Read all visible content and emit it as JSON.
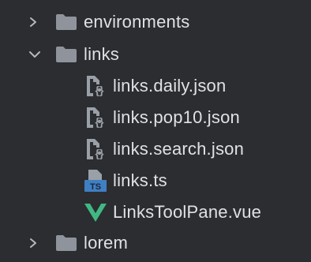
{
  "tree": {
    "items": [
      {
        "label": "environments",
        "type": "folder",
        "state": "collapsed",
        "icon": "folder-icon",
        "chevron": "chevron-right-icon"
      },
      {
        "label": "links",
        "type": "folder",
        "state": "expanded",
        "icon": "folder-icon",
        "chevron": "chevron-down-icon"
      },
      {
        "label": "links.daily.json",
        "type": "file",
        "icon": "json-file-icon"
      },
      {
        "label": "links.pop10.json",
        "type": "file",
        "icon": "json-file-icon"
      },
      {
        "label": "links.search.json",
        "type": "file",
        "icon": "json-file-icon"
      },
      {
        "label": "links.ts",
        "type": "file",
        "icon": "typescript-file-icon",
        "badge": "TS"
      },
      {
        "label": "LinksToolPane.vue",
        "type": "file",
        "icon": "vue-file-icon"
      },
      {
        "label": "lorem",
        "type": "folder",
        "state": "collapsed",
        "icon": "folder-icon",
        "chevron": "chevron-right-icon"
      }
    ]
  },
  "colors": {
    "background": "#2b2d30",
    "text": "#dfe1e5",
    "folder": "#8f949c",
    "chevron": "#b4b8bf",
    "file_icon": "#9aa0a8",
    "ts_badge": "#3f7fc4",
    "vue_green": "#41b883"
  }
}
